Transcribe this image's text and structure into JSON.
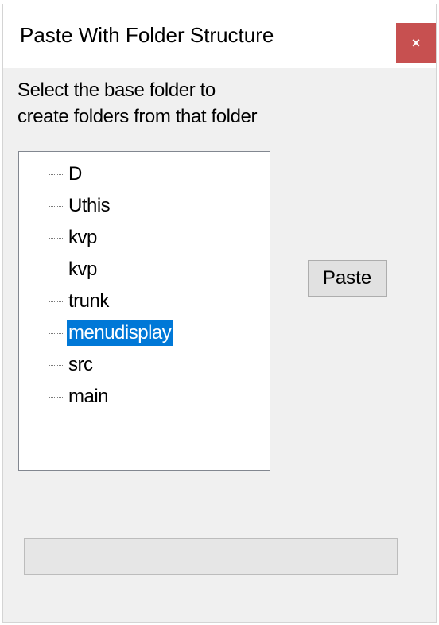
{
  "window": {
    "title": "Paste With Folder Structure",
    "close_glyph": "×"
  },
  "instructions": {
    "line1": "Select the base folder to",
    "line2": "create folders from that folder"
  },
  "tree": {
    "items": [
      {
        "label": "D",
        "selected": false
      },
      {
        "label": "Uthis",
        "selected": false
      },
      {
        "label": "kvp",
        "selected": false
      },
      {
        "label": "kvp",
        "selected": false
      },
      {
        "label": "trunk",
        "selected": false
      },
      {
        "label": "menudisplay",
        "selected": true
      },
      {
        "label": "src",
        "selected": false
      },
      {
        "label": "main",
        "selected": false
      }
    ]
  },
  "paste_button": {
    "label": "Paste"
  },
  "progress": {
    "value": 0
  },
  "colors": {
    "selection": "#0078d7",
    "close_button": "#c75050",
    "window_bg": "#f0f0f0"
  }
}
